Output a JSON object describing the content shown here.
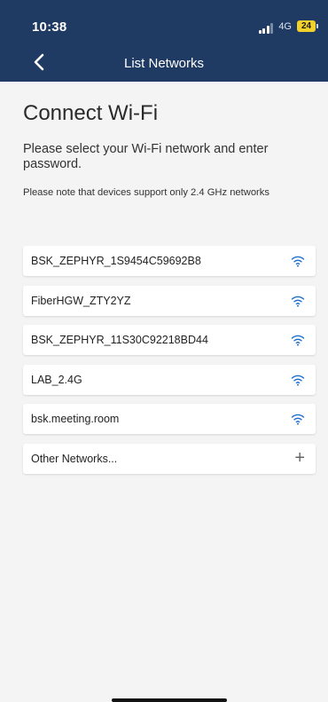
{
  "status_bar": {
    "time": "10:38",
    "network": "4G",
    "battery": "24"
  },
  "header": {
    "title": "List Networks",
    "back_icon": "chevron-left-icon"
  },
  "main": {
    "heading": "Connect Wi-Fi",
    "instruction": "Please select your Wi-Fi network and enter password.",
    "note": "Please note that devices support only 2.4 GHz networks"
  },
  "networks": [
    {
      "ssid": "BSK_ZEPHYR_1S9454C59692B8",
      "icon": "wifi-icon"
    },
    {
      "ssid": "FiberHGW_ZTY2YZ",
      "icon": "wifi-icon"
    },
    {
      "ssid": "BSK_ZEPHYR_11S30C92218BD44",
      "icon": "wifi-icon"
    },
    {
      "ssid": "LAB_2.4G",
      "icon": "wifi-icon"
    },
    {
      "ssid": "bsk.meeting.room",
      "icon": "wifi-icon"
    }
  ],
  "other": {
    "label": "Other Networks...",
    "icon": "plus-icon",
    "plus_glyph": "+"
  },
  "colors": {
    "header_bg": "#1f3b63",
    "page_bg": "#f4f4f5",
    "wifi_icon": "#1f6fd1",
    "battery": "#f2d22a"
  }
}
